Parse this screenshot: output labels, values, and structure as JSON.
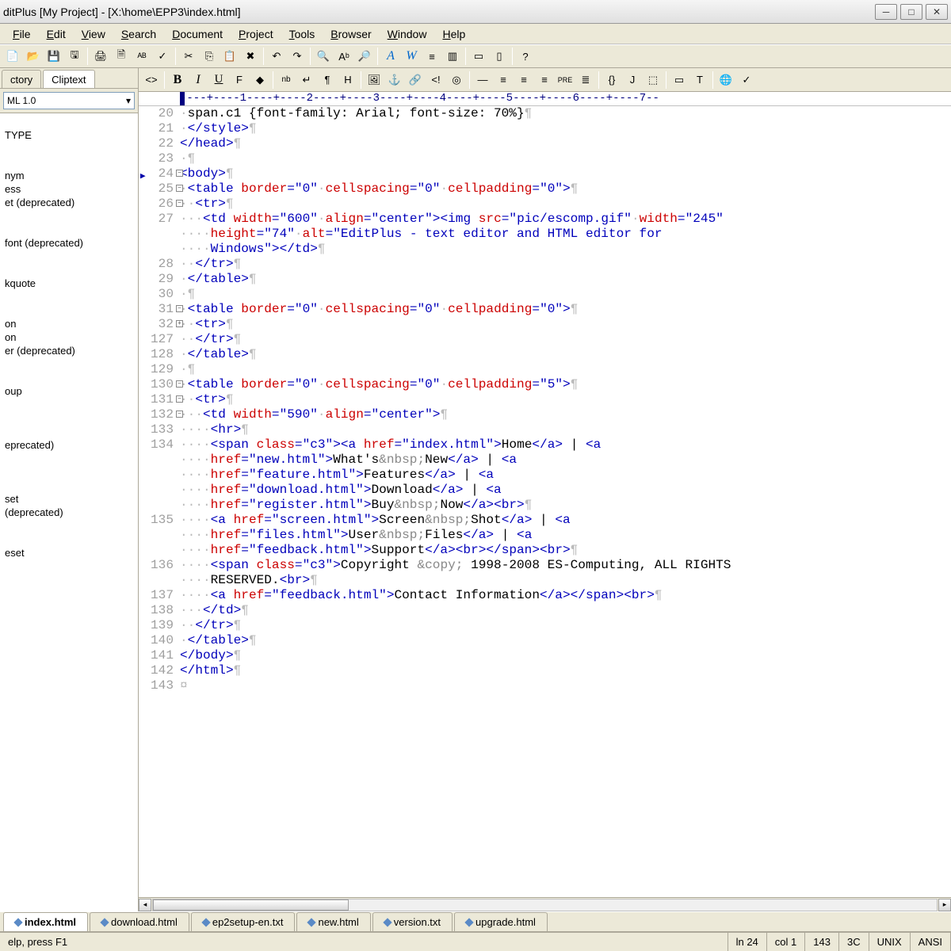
{
  "title": "ditPlus [My Project] - [X:\\home\\EPP3\\index.html]",
  "menu": [
    "File",
    "Edit",
    "View",
    "Search",
    "Document",
    "Project",
    "Tools",
    "Browser",
    "Window",
    "Help"
  ],
  "sidebar": {
    "tabs": [
      "ctory",
      "Cliptext"
    ],
    "active_tab": 1,
    "combo": "ML 1.0",
    "items": [
      "",
      "TYPE",
      "",
      "",
      "nym",
      "ess",
      "et (deprecated)",
      "",
      "",
      "font (deprecated)",
      "",
      "",
      "kquote",
      "",
      "",
      "on",
      "on",
      "er (deprecated)",
      "",
      "",
      "oup",
      "",
      "",
      "",
      "eprecated)",
      "",
      "",
      "",
      "set",
      "(deprecated)",
      "",
      "",
      "eset"
    ]
  },
  "ruler": "----+----1----+----2----+----3----+----4----+----5----+----6----+----7--",
  "code": [
    {
      "n": "20",
      "f": "",
      "t": [
        [
          " ",
          "ws"
        ],
        [
          "span.c1 {font-family: Arial; font-size: 70%}",
          "text"
        ],
        [
          "¶",
          "ws"
        ]
      ]
    },
    {
      "n": "21",
      "f": "",
      "t": [
        [
          " ",
          "ws"
        ],
        [
          "</style>",
          "tag"
        ],
        [
          "¶",
          "ws"
        ]
      ]
    },
    {
      "n": "22",
      "f": "",
      "t": [
        [
          "</head>",
          "tag"
        ],
        [
          "¶",
          "ws"
        ]
      ]
    },
    {
      "n": "23",
      "f": "",
      "t": [
        [
          " ¶",
          "ws"
        ]
      ]
    },
    {
      "n": "24",
      "f": "-",
      "arrow": true,
      "t": [
        [
          "<body>",
          "tag"
        ],
        [
          "¶",
          "ws"
        ]
      ]
    },
    {
      "n": "25",
      "f": "-",
      "t": [
        [
          " ",
          "ws"
        ],
        [
          "<table ",
          "tag"
        ],
        [
          "border",
          "attr"
        ],
        [
          "=",
          "tag"
        ],
        [
          "\"0\"",
          "str"
        ],
        [
          " ",
          "ws"
        ],
        [
          "cellspacing",
          "attr"
        ],
        [
          "=",
          "tag"
        ],
        [
          "\"0\"",
          "str"
        ],
        [
          " ",
          "ws"
        ],
        [
          "cellpadding",
          "attr"
        ],
        [
          "=",
          "tag"
        ],
        [
          "\"0\"",
          "str"
        ],
        [
          ">",
          "tag"
        ],
        [
          "¶",
          "ws"
        ]
      ]
    },
    {
      "n": "26",
      "f": "-",
      "t": [
        [
          "  ",
          "ws"
        ],
        [
          "<tr>",
          "tag"
        ],
        [
          "¶",
          "ws"
        ]
      ]
    },
    {
      "n": "27",
      "f": "",
      "t": [
        [
          "   ",
          "ws"
        ],
        [
          "<td ",
          "tag"
        ],
        [
          "width",
          "attr"
        ],
        [
          "=",
          "tag"
        ],
        [
          "\"600\"",
          "str"
        ],
        [
          " ",
          "ws"
        ],
        [
          "align",
          "attr"
        ],
        [
          "=",
          "tag"
        ],
        [
          "\"center\"",
          "str"
        ],
        [
          ">",
          "tag"
        ],
        [
          "<img ",
          "tag"
        ],
        [
          "src",
          "attr"
        ],
        [
          "=",
          "tag"
        ],
        [
          "\"pic/escomp.gif\"",
          "str"
        ],
        [
          " ",
          "ws"
        ],
        [
          "width",
          "attr"
        ],
        [
          "=",
          "tag"
        ],
        [
          "\"245\"",
          "str"
        ]
      ]
    },
    {
      "n": "",
      "f": "",
      "t": [
        [
          "    ",
          "ws"
        ],
        [
          "height",
          "attr"
        ],
        [
          "=",
          "tag"
        ],
        [
          "\"74\"",
          "str"
        ],
        [
          " ",
          "ws"
        ],
        [
          "alt",
          "attr"
        ],
        [
          "=",
          "tag"
        ],
        [
          "\"EditPlus - text editor and HTML editor for",
          "str"
        ]
      ]
    },
    {
      "n": "",
      "f": "",
      "t": [
        [
          "    ",
          "ws"
        ],
        [
          "Windows\"",
          "str"
        ],
        [
          ">",
          "tag"
        ],
        [
          "</td>",
          "tag"
        ],
        [
          "¶",
          "ws"
        ]
      ]
    },
    {
      "n": "28",
      "f": "",
      "t": [
        [
          "  ",
          "ws"
        ],
        [
          "</tr>",
          "tag"
        ],
        [
          "¶",
          "ws"
        ]
      ]
    },
    {
      "n": "29",
      "f": "",
      "t": [
        [
          " ",
          "ws"
        ],
        [
          "</table>",
          "tag"
        ],
        [
          "¶",
          "ws"
        ]
      ]
    },
    {
      "n": "30",
      "f": "",
      "t": [
        [
          " ¶",
          "ws"
        ]
      ]
    },
    {
      "n": "31",
      "f": "-",
      "t": [
        [
          " ",
          "ws"
        ],
        [
          "<table ",
          "tag"
        ],
        [
          "border",
          "attr"
        ],
        [
          "=",
          "tag"
        ],
        [
          "\"0\"",
          "str"
        ],
        [
          " ",
          "ws"
        ],
        [
          "cellspacing",
          "attr"
        ],
        [
          "=",
          "tag"
        ],
        [
          "\"0\"",
          "str"
        ],
        [
          " ",
          "ws"
        ],
        [
          "cellpadding",
          "attr"
        ],
        [
          "=",
          "tag"
        ],
        [
          "\"0\"",
          "str"
        ],
        [
          ">",
          "tag"
        ],
        [
          "¶",
          "ws"
        ]
      ]
    },
    {
      "n": "32",
      "f": "+",
      "t": [
        [
          "  ",
          "ws"
        ],
        [
          "<tr>",
          "tag"
        ],
        [
          "¶",
          "ws"
        ]
      ]
    },
    {
      "n": "127",
      "f": "",
      "t": [
        [
          "  ",
          "ws"
        ],
        [
          "</tr>",
          "tag"
        ],
        [
          "¶",
          "ws"
        ]
      ]
    },
    {
      "n": "128",
      "f": "",
      "t": [
        [
          " ",
          "ws"
        ],
        [
          "</table>",
          "tag"
        ],
        [
          "¶",
          "ws"
        ]
      ]
    },
    {
      "n": "129",
      "f": "",
      "t": [
        [
          " ¶",
          "ws"
        ]
      ]
    },
    {
      "n": "130",
      "f": "-",
      "t": [
        [
          " ",
          "ws"
        ],
        [
          "<table ",
          "tag"
        ],
        [
          "border",
          "attr"
        ],
        [
          "=",
          "tag"
        ],
        [
          "\"0\"",
          "str"
        ],
        [
          " ",
          "ws"
        ],
        [
          "cellspacing",
          "attr"
        ],
        [
          "=",
          "tag"
        ],
        [
          "\"0\"",
          "str"
        ],
        [
          " ",
          "ws"
        ],
        [
          "cellpadding",
          "attr"
        ],
        [
          "=",
          "tag"
        ],
        [
          "\"5\"",
          "str"
        ],
        [
          ">",
          "tag"
        ],
        [
          "¶",
          "ws"
        ]
      ]
    },
    {
      "n": "131",
      "f": "-",
      "t": [
        [
          "  ",
          "ws"
        ],
        [
          "<tr>",
          "tag"
        ],
        [
          "¶",
          "ws"
        ]
      ]
    },
    {
      "n": "132",
      "f": "-",
      "t": [
        [
          "   ",
          "ws"
        ],
        [
          "<td ",
          "tag"
        ],
        [
          "width",
          "attr"
        ],
        [
          "=",
          "tag"
        ],
        [
          "\"590\"",
          "str"
        ],
        [
          " ",
          "ws"
        ],
        [
          "align",
          "attr"
        ],
        [
          "=",
          "tag"
        ],
        [
          "\"center\"",
          "str"
        ],
        [
          ">",
          "tag"
        ],
        [
          "¶",
          "ws"
        ]
      ]
    },
    {
      "n": "133",
      "f": "",
      "t": [
        [
          "    ",
          "ws"
        ],
        [
          "<hr>",
          "tag"
        ],
        [
          "¶",
          "ws"
        ]
      ]
    },
    {
      "n": "134",
      "f": "",
      "t": [
        [
          "    ",
          "ws"
        ],
        [
          "<span ",
          "tag"
        ],
        [
          "class",
          "attr"
        ],
        [
          "=",
          "tag"
        ],
        [
          "\"c3\"",
          "str"
        ],
        [
          ">",
          "tag"
        ],
        [
          "<a ",
          "tag"
        ],
        [
          "href",
          "attr"
        ],
        [
          "=",
          "tag"
        ],
        [
          "\"index.html\"",
          "str"
        ],
        [
          ">",
          "tag"
        ],
        [
          "Home",
          "text"
        ],
        [
          "</a>",
          "tag"
        ],
        [
          " | ",
          "text"
        ],
        [
          "<a",
          "tag"
        ]
      ]
    },
    {
      "n": "",
      "f": "",
      "t": [
        [
          "    ",
          "ws"
        ],
        [
          "href",
          "attr"
        ],
        [
          "=",
          "tag"
        ],
        [
          "\"new.html\"",
          "str"
        ],
        [
          ">",
          "tag"
        ],
        [
          "What's",
          "text"
        ],
        [
          "&nbsp;",
          "dim"
        ],
        [
          "New",
          "text"
        ],
        [
          "</a>",
          "tag"
        ],
        [
          " | ",
          "text"
        ],
        [
          "<a",
          "tag"
        ]
      ]
    },
    {
      "n": "",
      "f": "",
      "t": [
        [
          "    ",
          "ws"
        ],
        [
          "href",
          "attr"
        ],
        [
          "=",
          "tag"
        ],
        [
          "\"feature.html\"",
          "str"
        ],
        [
          ">",
          "tag"
        ],
        [
          "Features",
          "text"
        ],
        [
          "</a>",
          "tag"
        ],
        [
          " | ",
          "text"
        ],
        [
          "<a",
          "tag"
        ]
      ]
    },
    {
      "n": "",
      "f": "",
      "t": [
        [
          "    ",
          "ws"
        ],
        [
          "href",
          "attr"
        ],
        [
          "=",
          "tag"
        ],
        [
          "\"download.html\"",
          "str"
        ],
        [
          ">",
          "tag"
        ],
        [
          "Download",
          "text"
        ],
        [
          "</a>",
          "tag"
        ],
        [
          " | ",
          "text"
        ],
        [
          "<a",
          "tag"
        ]
      ]
    },
    {
      "n": "",
      "f": "",
      "t": [
        [
          "    ",
          "ws"
        ],
        [
          "href",
          "attr"
        ],
        [
          "=",
          "tag"
        ],
        [
          "\"register.html\"",
          "str"
        ],
        [
          ">",
          "tag"
        ],
        [
          "Buy",
          "text"
        ],
        [
          "&nbsp;",
          "dim"
        ],
        [
          "Now",
          "text"
        ],
        [
          "</a>",
          "tag"
        ],
        [
          "<br>",
          "tag"
        ],
        [
          "¶",
          "ws"
        ]
      ]
    },
    {
      "n": "135",
      "f": "",
      "t": [
        [
          "    ",
          "ws"
        ],
        [
          "<a ",
          "tag"
        ],
        [
          "href",
          "attr"
        ],
        [
          "=",
          "tag"
        ],
        [
          "\"screen.html\"",
          "str"
        ],
        [
          ">",
          "tag"
        ],
        [
          "Screen",
          "text"
        ],
        [
          "&nbsp;",
          "dim"
        ],
        [
          "Shot",
          "text"
        ],
        [
          "</a>",
          "tag"
        ],
        [
          " | ",
          "text"
        ],
        [
          "<a",
          "tag"
        ]
      ]
    },
    {
      "n": "",
      "f": "",
      "t": [
        [
          "    ",
          "ws"
        ],
        [
          "href",
          "attr"
        ],
        [
          "=",
          "tag"
        ],
        [
          "\"files.html\"",
          "str"
        ],
        [
          ">",
          "tag"
        ],
        [
          "User",
          "text"
        ],
        [
          "&nbsp;",
          "dim"
        ],
        [
          "Files",
          "text"
        ],
        [
          "</a>",
          "tag"
        ],
        [
          " | ",
          "text"
        ],
        [
          "<a",
          "tag"
        ]
      ]
    },
    {
      "n": "",
      "f": "",
      "t": [
        [
          "    ",
          "ws"
        ],
        [
          "href",
          "attr"
        ],
        [
          "=",
          "tag"
        ],
        [
          "\"feedback.html\"",
          "str"
        ],
        [
          ">",
          "tag"
        ],
        [
          "Support",
          "text"
        ],
        [
          "</a>",
          "tag"
        ],
        [
          "<br>",
          "tag"
        ],
        [
          "</span>",
          "tag"
        ],
        [
          "<br>",
          "tag"
        ],
        [
          "¶",
          "ws"
        ]
      ]
    },
    {
      "n": "136",
      "f": "",
      "t": [
        [
          "    ",
          "ws"
        ],
        [
          "<span ",
          "tag"
        ],
        [
          "class",
          "attr"
        ],
        [
          "=",
          "tag"
        ],
        [
          "\"c3\"",
          "str"
        ],
        [
          ">",
          "tag"
        ],
        [
          "Copyright ",
          "text"
        ],
        [
          "&copy;",
          "dim"
        ],
        [
          " 1998-2008 ES-Computing, ALL RIGHTS",
          "text"
        ]
      ]
    },
    {
      "n": "",
      "f": "",
      "t": [
        [
          "    ",
          "ws"
        ],
        [
          "RESERVED.",
          "text"
        ],
        [
          "<br>",
          "tag"
        ],
        [
          "¶",
          "ws"
        ]
      ]
    },
    {
      "n": "137",
      "f": "",
      "t": [
        [
          "    ",
          "ws"
        ],
        [
          "<a ",
          "tag"
        ],
        [
          "href",
          "attr"
        ],
        [
          "=",
          "tag"
        ],
        [
          "\"feedback.html\"",
          "str"
        ],
        [
          ">",
          "tag"
        ],
        [
          "Contact Information",
          "text"
        ],
        [
          "</a>",
          "tag"
        ],
        [
          "</span>",
          "tag"
        ],
        [
          "<br>",
          "tag"
        ],
        [
          "¶",
          "ws"
        ]
      ]
    },
    {
      "n": "138",
      "f": "",
      "t": [
        [
          "   ",
          "ws"
        ],
        [
          "</td>",
          "tag"
        ],
        [
          "¶",
          "ws"
        ]
      ]
    },
    {
      "n": "139",
      "f": "",
      "t": [
        [
          "  ",
          "ws"
        ],
        [
          "</tr>",
          "tag"
        ],
        [
          "¶",
          "ws"
        ]
      ]
    },
    {
      "n": "140",
      "f": "",
      "t": [
        [
          " ",
          "ws"
        ],
        [
          "</table>",
          "tag"
        ],
        [
          "¶",
          "ws"
        ]
      ]
    },
    {
      "n": "141",
      "f": "",
      "t": [
        [
          "</body>",
          "tag"
        ],
        [
          "¶",
          "ws"
        ]
      ]
    },
    {
      "n": "142",
      "f": "",
      "t": [
        [
          "</html>",
          "tag"
        ],
        [
          "¶",
          "ws"
        ]
      ]
    },
    {
      "n": "143",
      "f": "",
      "t": [
        [
          "¤",
          "ws"
        ]
      ]
    }
  ],
  "doc_tabs": [
    "index.html",
    "download.html",
    "ep2setup-en.txt",
    "new.html",
    "version.txt",
    "upgrade.html"
  ],
  "active_doc_tab": 0,
  "status": {
    "help": "elp, press F1",
    "ln": "ln 24",
    "col": "col 1",
    "lines": "143",
    "enc": "3C",
    "os": "UNIX",
    "cs": "ANSI"
  },
  "toolbar1_icons": [
    "new-icon",
    "open-icon",
    "save-icon",
    "save-all-icon",
    "",
    "print-icon",
    "print-preview-icon",
    "spell-icon",
    "check-icon",
    "",
    "cut-icon",
    "copy-icon",
    "paste-icon",
    "delete-icon",
    "",
    "undo-icon",
    "redo-icon",
    "",
    "find-icon",
    "replace-icon",
    "findfiles-icon",
    "",
    "format-a-icon",
    "word-icon",
    "line-icon",
    "column-icon",
    "",
    "window1-icon",
    "window2-icon",
    "",
    "help-icon"
  ],
  "toolbar2_icons": [
    "tag-icon",
    "",
    "bold-icon",
    "italic-icon",
    "underline-icon",
    "font-icon",
    "color-icon",
    "",
    "nbsp-icon",
    "br-icon",
    "para-icon",
    "heading-icon",
    "",
    "image-icon",
    "anchor-icon",
    "link-icon",
    "comment-icon",
    "target-icon",
    "",
    "hr-icon",
    "left-icon",
    "center-icon",
    "right-icon",
    "pre-icon",
    "list-icon",
    "",
    "script-icon",
    "applet-icon",
    "object-icon",
    "",
    "form-icon",
    "text-icon",
    "",
    "browser-icon",
    "validate-icon"
  ]
}
